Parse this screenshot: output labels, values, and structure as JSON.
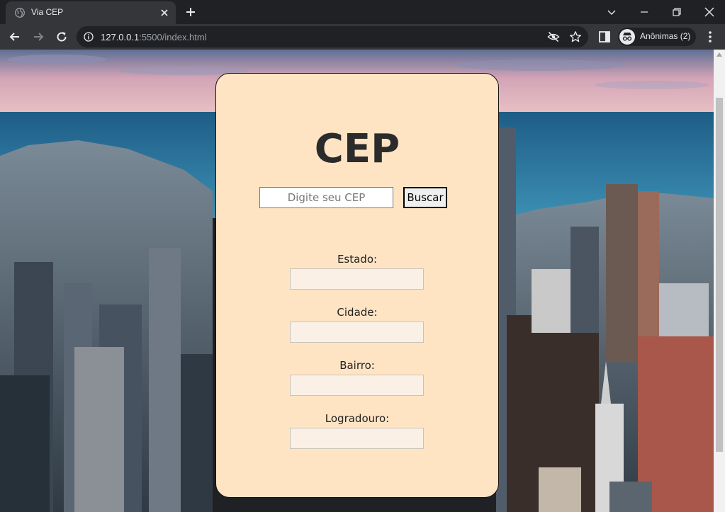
{
  "browser": {
    "tab_title": "Via CEP",
    "url_host": "127.0.0.1",
    "url_rest": ":5500/index.html",
    "profile_label": "Anônimas (2)"
  },
  "page": {
    "title": "CEP",
    "cep_placeholder": "Digite seu CEP",
    "cep_value": "",
    "search_button": "Buscar",
    "fields": [
      {
        "label": "Estado:",
        "value": ""
      },
      {
        "label": "Cidade:",
        "value": ""
      },
      {
        "label": "Bairro:",
        "value": ""
      },
      {
        "label": "Logradouro:",
        "value": ""
      }
    ]
  },
  "colors": {
    "card_bg": "#ffe4c4",
    "field_bg": "#faf0e6",
    "chrome_dark": "#202124",
    "chrome_toolbar": "#35363a"
  }
}
